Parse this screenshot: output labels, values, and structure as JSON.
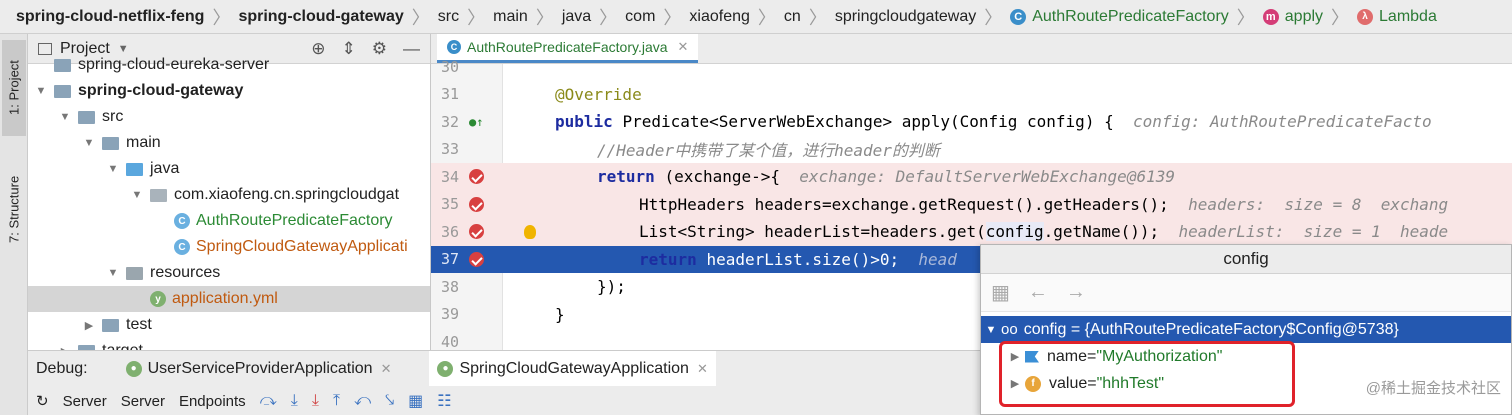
{
  "breadcrumb": [
    {
      "text": "spring-cloud-netflix-feng",
      "style": "bold"
    },
    {
      "text": "spring-cloud-gateway",
      "style": "bold"
    },
    {
      "text": "src"
    },
    {
      "text": "main"
    },
    {
      "text": "java"
    },
    {
      "text": "com"
    },
    {
      "text": "xiaofeng"
    },
    {
      "text": "cn"
    },
    {
      "text": "springcloudgateway"
    },
    {
      "text": "AuthRoutePredicateFactory",
      "icon": "C"
    },
    {
      "text": "apply",
      "icon": "m"
    },
    {
      "text": "Lambda",
      "icon": "λ"
    }
  ],
  "left_strip": {
    "project_tab": "1: Project",
    "structure_tab": "7: Structure"
  },
  "project": {
    "title": "Project",
    "tree": [
      {
        "label": "spring-cloud-eureka-server",
        "level": 0,
        "type": "module",
        "arrow": "",
        "partial": true
      },
      {
        "label": "spring-cloud-gateway",
        "level": 0,
        "type": "module",
        "arrow": "▼",
        "bold": true
      },
      {
        "label": "src",
        "level": 1,
        "type": "folder",
        "arrow": "▼"
      },
      {
        "label": "main",
        "level": 2,
        "type": "folder",
        "arrow": "▼"
      },
      {
        "label": "java",
        "level": 3,
        "type": "folder-blue",
        "arrow": "▼"
      },
      {
        "label": "com.xiaofeng.cn.springcloudgat",
        "level": 4,
        "type": "package",
        "arrow": "▼"
      },
      {
        "label": "AuthRoutePredicateFactory",
        "level": 5,
        "type": "class",
        "color": "green"
      },
      {
        "label": "SpringCloudGatewayApplicati",
        "level": 5,
        "type": "class",
        "color": "orange"
      },
      {
        "label": "resources",
        "level": 3,
        "type": "resources",
        "arrow": "▼"
      },
      {
        "label": "application.yml",
        "level": 4,
        "type": "yml",
        "color": "orange",
        "selected": true
      },
      {
        "label": "test",
        "level": 2,
        "type": "folder",
        "arrow": "▶"
      },
      {
        "label": "target",
        "level": 1,
        "type": "folder",
        "arrow": "▶",
        "partial": true
      }
    ]
  },
  "editor": {
    "tab_label": "AuthRoutePredicateFactory.java",
    "lines": [
      {
        "num": "30",
        "partial": true
      },
      {
        "num": "31",
        "code": [
          {
            "t": "@Override",
            "c": "ann"
          }
        ],
        "indent": 0
      },
      {
        "num": "32",
        "mark": "override",
        "code": [
          {
            "t": "public ",
            "c": "kw"
          },
          {
            "t": "Predicate<ServerWebExchange> apply(Config config) {  "
          },
          {
            "t": "config: AuthRoutePredicateFacto",
            "c": "inl"
          }
        ],
        "indent": 0
      },
      {
        "num": "33",
        "code": [
          {
            "t": "//Header中携带了某个值，进行header的判断",
            "c": "cmt"
          }
        ],
        "indent": 1
      },
      {
        "num": "34",
        "mark": "bp",
        "code": [
          {
            "t": "return ",
            "c": "kw"
          },
          {
            "t": "(exchange->{  "
          },
          {
            "t": "exchange: DefaultServerWebExchange@6139",
            "c": "inl"
          }
        ],
        "indent": 1
      },
      {
        "num": "35",
        "mark": "bp",
        "code": [
          {
            "t": "HttpHeaders headers=exchange.getRequest().getHeaders();  "
          },
          {
            "t": "headers:  size = 8  exchang",
            "c": "inl"
          }
        ],
        "indent": 2
      },
      {
        "num": "36",
        "mark": "bp",
        "bulb": true,
        "code": [
          {
            "t": "List<String> headerList=headers.get("
          },
          {
            "t": "config",
            "c": "cfgref"
          },
          {
            "t": ".getName());  "
          },
          {
            "t": "headerList:  size = 1  heade",
            "c": "inl"
          }
        ],
        "indent": 2
      },
      {
        "num": "37",
        "mark": "bp",
        "exec": true,
        "code": [
          {
            "t": "return ",
            "c": "kw"
          },
          {
            "t": "headerList.size()>0;  "
          },
          {
            "t": "head",
            "c": "inl"
          }
        ],
        "indent": 2
      },
      {
        "num": "38",
        "code": [
          {
            "t": "});"
          }
        ],
        "indent": 1
      },
      {
        "num": "39",
        "code": [
          {
            "t": "}"
          }
        ],
        "indent": 0
      },
      {
        "num": "40",
        "code": [],
        "indent": 0
      }
    ]
  },
  "debug": {
    "label": "Debug:",
    "tabs": [
      {
        "label": "UserServiceProviderApplication",
        "active": false
      },
      {
        "label": "SpringCloudGatewayApplication",
        "active": true
      }
    ],
    "toolbar": [
      "Server",
      "Server",
      "Endpoints"
    ]
  },
  "popup": {
    "title": "config",
    "root": "config = {AuthRoutePredicateFactory$Config@5738}",
    "fields": [
      {
        "name": "name",
        "value": "\"MyAuthorization\"",
        "icon": "flag"
      },
      {
        "name": "value",
        "value": "\"hhhTest\"",
        "icon": "f"
      }
    ]
  },
  "watermark": "@稀土掘金技术社区",
  "colors": {
    "accent": "#2458b0",
    "breakpoint": "#d84040",
    "highlight_box": "#e0222a"
  }
}
